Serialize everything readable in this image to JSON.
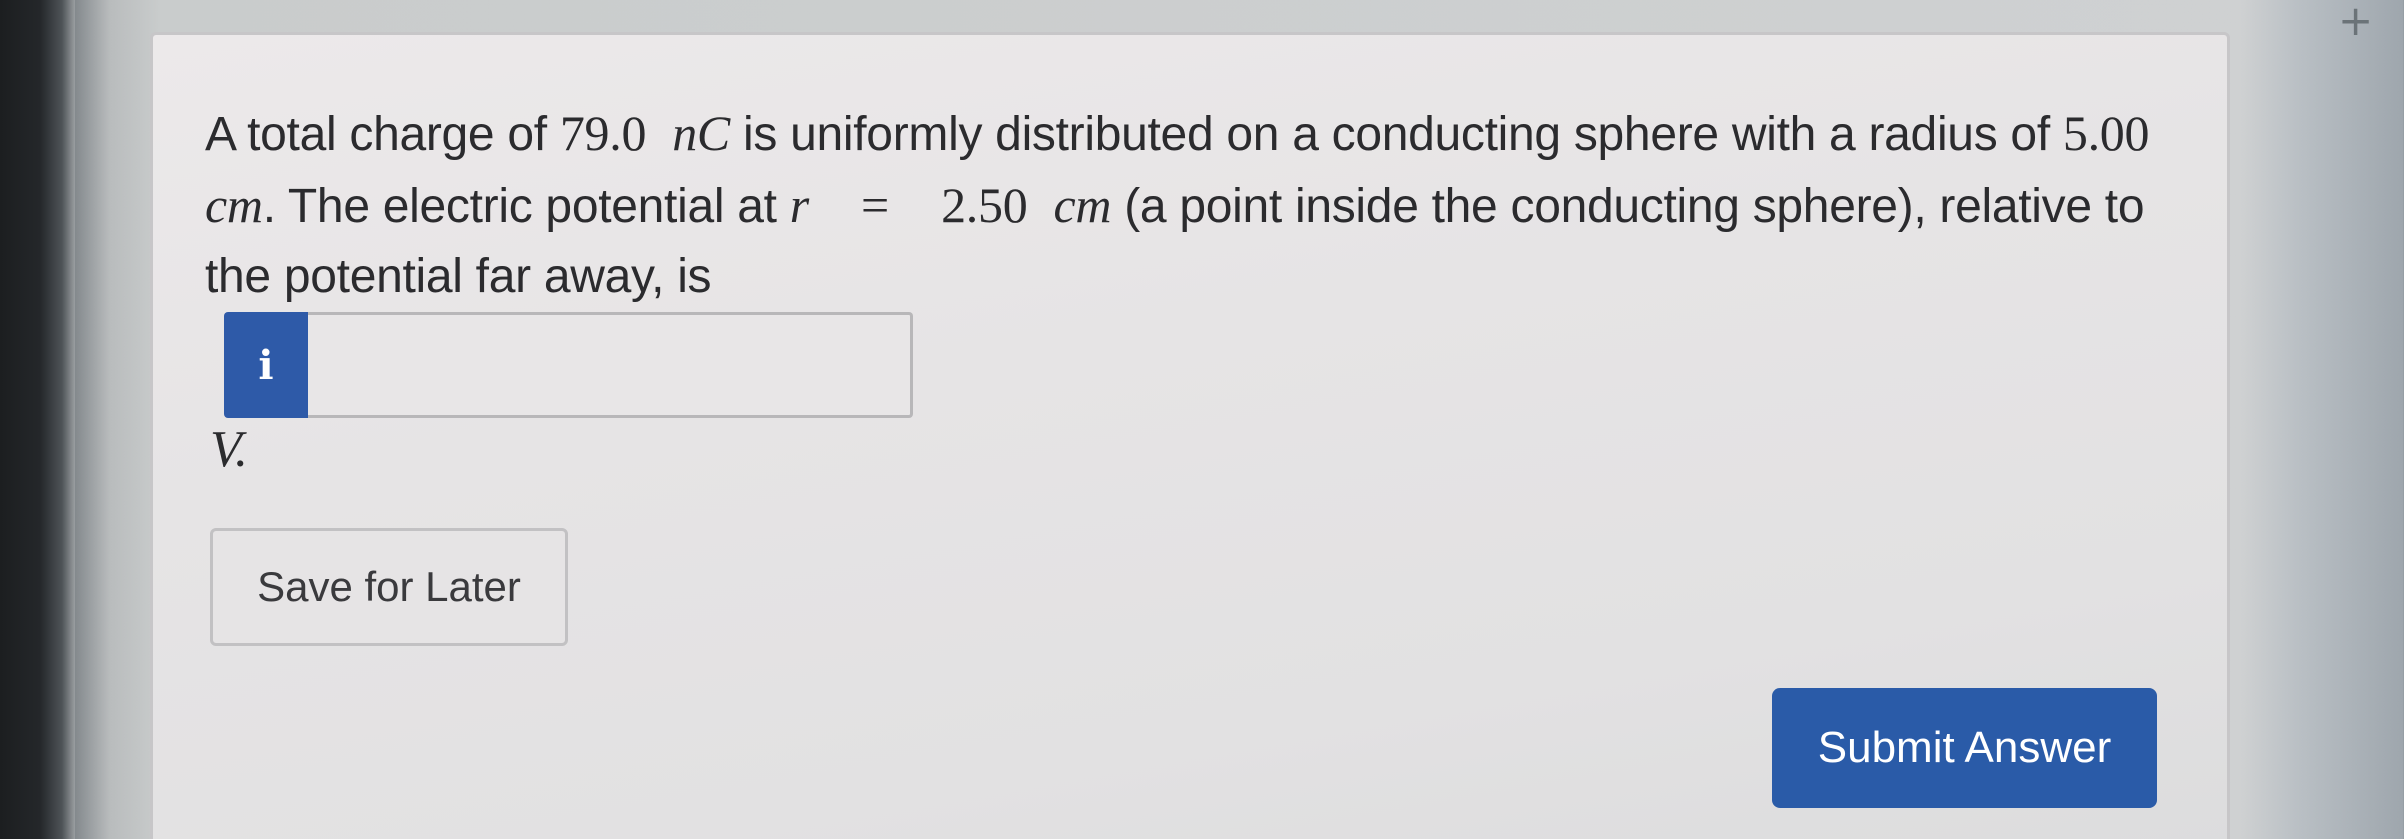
{
  "question": {
    "part1": "A total charge of ",
    "charge_value": "79.0",
    "charge_unit": "nC",
    "part2": " is uniformly distributed on a conducting sphere with a radius of ",
    "radius_value": "5.00",
    "radius_unit": "cm",
    "part3": ". The electric potential at ",
    "point_var": "r",
    "equals": "=",
    "point_value": "2.50",
    "point_unit": "cm",
    "part4": " (a point inside the conducting sphere), relative to the potential far away, is"
  },
  "answer": {
    "info_icon": "i",
    "value": "",
    "placeholder": "",
    "unit": "V."
  },
  "buttons": {
    "save_label": "Save for Later",
    "submit_label": "Submit Answer"
  },
  "icons": {
    "plus": "+"
  },
  "colors": {
    "accent": "#2a5ba8",
    "text": "#2b2b2e"
  }
}
